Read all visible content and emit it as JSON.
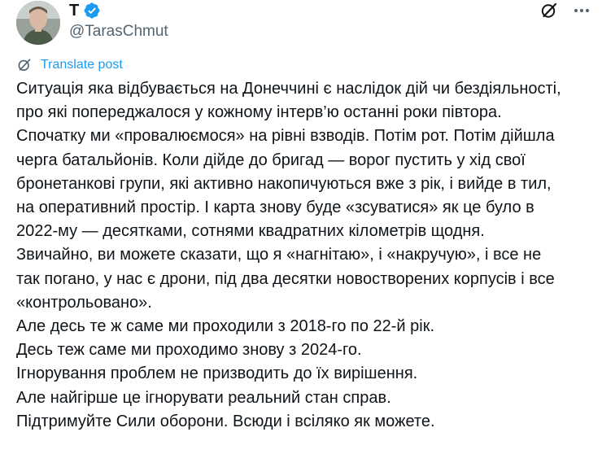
{
  "author": {
    "display_name": "T",
    "handle": "@TarasChmut",
    "verified": true,
    "verified_color": "#1d9bf0"
  },
  "header_icons": [
    "grok-icon",
    "more-icon"
  ],
  "translate": {
    "label": "Translate post",
    "color": "#1d9bf0"
  },
  "post": {
    "lines": [
      "Ситуація яка відбувається на Донеччині є наслідок дій чи бездіяльності,",
      "про які попереджалося у кожному інтерв’ю останні роки півтора.",
      "Спочатку ми «провалюємося» на рівні взводів. Потім рот. Потім дійшла",
      "черга батальйонів. Коли дійде до бригад — ворог пустить у хід свої",
      "бронетанкові групи, які активно накопичуються вже з рік, і вийде в тил,",
      "на оперативний простір. І карта знову буде «зсуватися» як це було в",
      "2022-му — десятками, сотнями квадратних кілометрів щодня.",
      "Звичайно, ви можете сказати, що я «нагнітаю», і «накручую», і все не",
      "так погано, у нас є дрони, під два десятки новостворених корпусів і все",
      "«контрольовано».",
      "Але десь те ж саме ми проходили з 2018-го по 22-й рік.",
      "Десь теж саме ми проходимо знову з 2024-го.",
      "Ігнорування проблем не призводить до їх вирішення.",
      "Але найгірше це ігнорувати реальний стан справ.",
      "Підтримуйте Сили оборони. Всюди і всіляко як можете."
    ]
  }
}
